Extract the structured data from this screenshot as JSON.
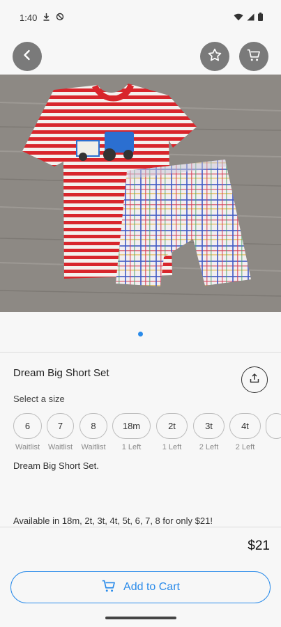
{
  "status_bar": {
    "time": "1:40",
    "icons": [
      "download-icon",
      "no-disturb-icon",
      "wifi-icon",
      "signal-icon",
      "battery-icon"
    ]
  },
  "header": {
    "back_icon": "back-arrow-icon",
    "favorite_icon": "star-icon",
    "cart_icon": "cart-icon"
  },
  "product": {
    "title": "Dream Big Short Set",
    "select_size_label": "Select a size",
    "sizes": [
      {
        "label": "6",
        "note": "Waitlist"
      },
      {
        "label": "7",
        "note": "Waitlist"
      },
      {
        "label": "8",
        "note": "Waitlist"
      },
      {
        "label": "18m",
        "note": "1 Left"
      },
      {
        "label": "2t",
        "note": "1 Left"
      },
      {
        "label": "3t",
        "note": "2 Left"
      },
      {
        "label": "4t",
        "note": "2 Left"
      }
    ],
    "description_line1": "Dream Big Short Set.",
    "description_line2": "Available in 18m, 2t, 3t, 4t, 5t, 6, 7, 8 for only $21!",
    "price": "$21"
  },
  "actions": {
    "add_to_cart_label": "Add to Cart"
  },
  "colors": {
    "accent": "#2a8bea",
    "header_button_bg": "#7a7a7a"
  }
}
